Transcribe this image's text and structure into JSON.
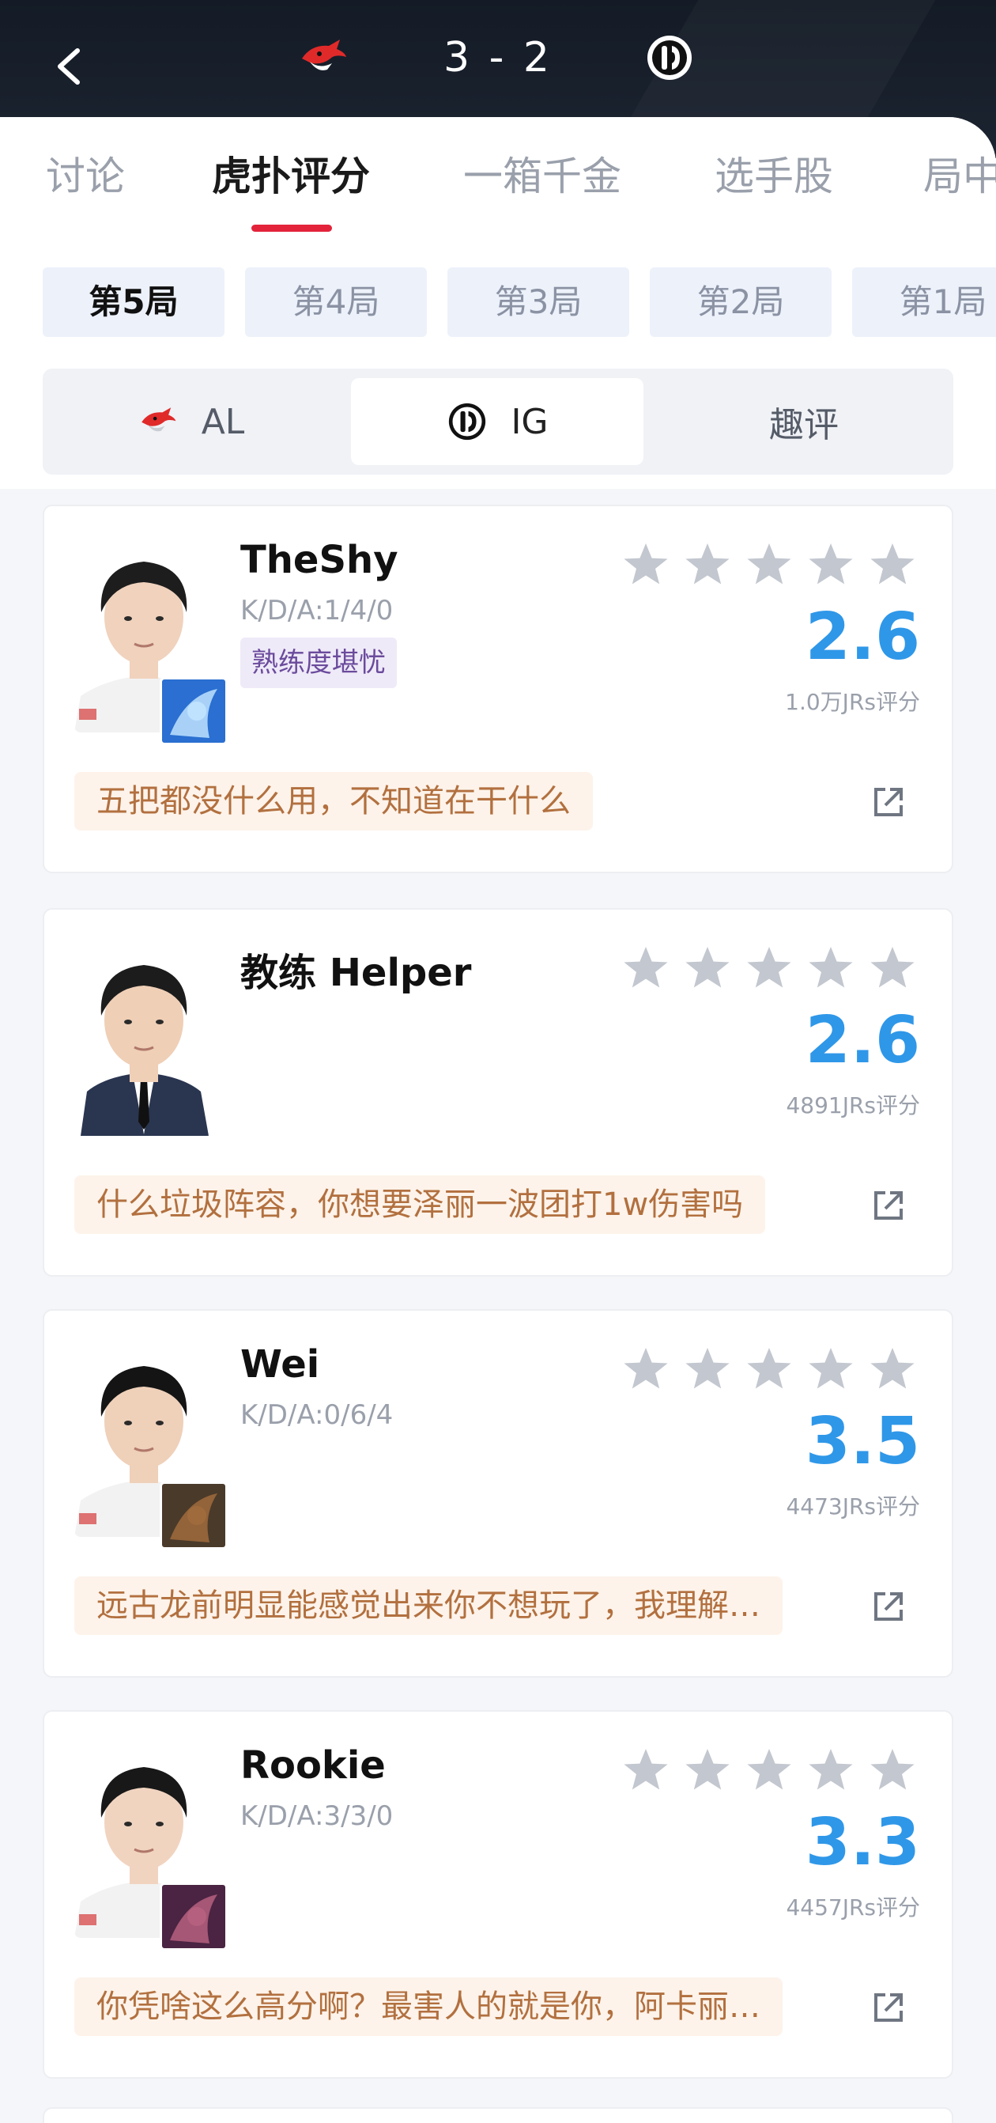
{
  "header": {
    "score": "3 - 2",
    "left_team_logo": "al-shark-logo",
    "right_team_logo": "ig-logo"
  },
  "tabs": [
    {
      "label": "讨论",
      "active": false
    },
    {
      "label": "虎扑评分",
      "active": true
    },
    {
      "label": "一箱千金",
      "active": false
    },
    {
      "label": "选手股",
      "active": false
    },
    {
      "label": "局中",
      "active": false
    }
  ],
  "games": [
    {
      "label": "第5局",
      "active": true
    },
    {
      "label": "第4局",
      "active": false
    },
    {
      "label": "第3局",
      "active": false
    },
    {
      "label": "第2局",
      "active": false
    },
    {
      "label": "第1局",
      "active": false
    }
  ],
  "segment": [
    {
      "label": "AL",
      "icon": "al-shark-logo",
      "active": false
    },
    {
      "label": "IG",
      "icon": "ig-logo",
      "active": true
    },
    {
      "label": "趣评",
      "icon": "",
      "active": false
    }
  ],
  "players": [
    {
      "name": "TheShy",
      "kda": "K/D/A:1/4/0",
      "tag": "熟练度堪忧",
      "rating": "2.6",
      "count": "1.0万JRs评分",
      "comment": "五把都没什么用，不知道在干什么",
      "stars_filled": 0
    },
    {
      "name": "教练 Helper",
      "kda": "",
      "tag": "",
      "rating": "2.6",
      "count": "4891JRs评分",
      "comment": "什么垃圾阵容，你想要泽丽一波团打1w伤害吗",
      "stars_filled": 0
    },
    {
      "name": "Wei",
      "kda": "K/D/A:0/6/4",
      "tag": "",
      "rating": "3.5",
      "count": "4473JRs评分",
      "comment": "远古龙前明显能感觉出来你不想玩了，我理解…",
      "stars_filled": 0
    },
    {
      "name": "Rookie",
      "kda": "K/D/A:3/3/0",
      "tag": "",
      "rating": "3.3",
      "count": "4457JRs评分",
      "comment": "你凭啥这么高分啊？最害人的就是你，阿卡丽…",
      "stars_filled": 0
    }
  ],
  "colors": {
    "header_bg": "#141b26",
    "accent_red": "#e3233a",
    "rating_blue": "#2f97e8",
    "comment_text": "#b2703f",
    "comment_bg": "#fdf3ea",
    "star_empty": "#c3c7cf"
  }
}
